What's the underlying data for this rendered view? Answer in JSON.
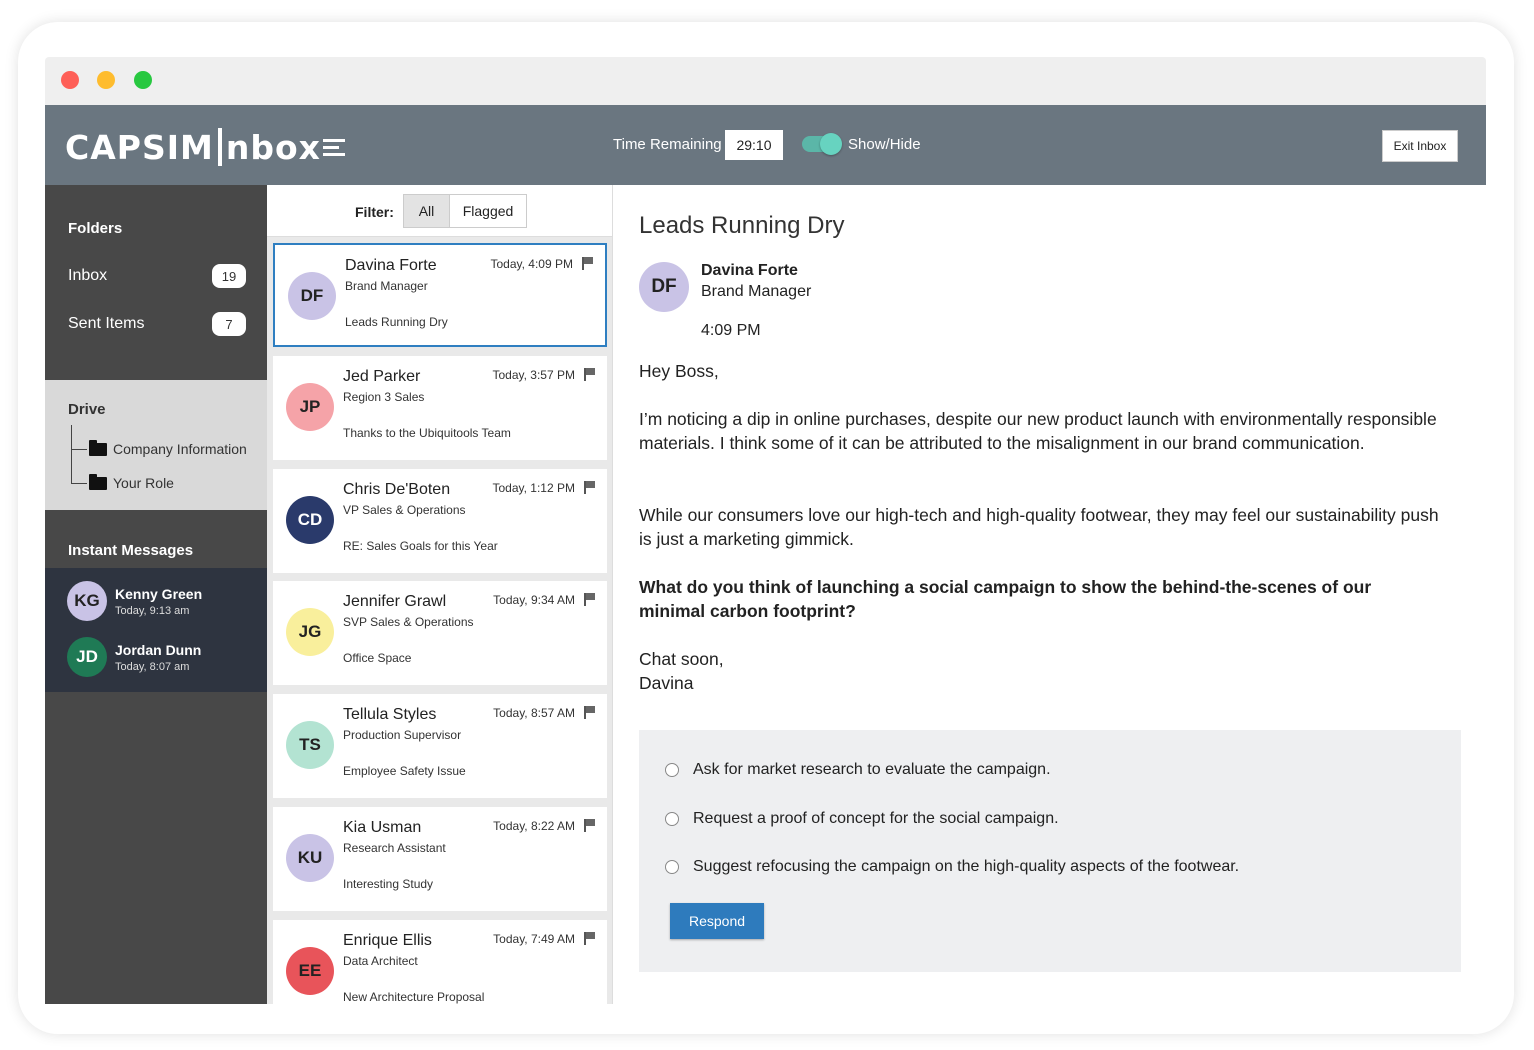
{
  "header": {
    "logo_left": "CAPSIM",
    "logo_right": "nbox",
    "timer_label": "Time Remaining",
    "timer_value": "29:10",
    "toggle_label": "Show/Hide",
    "toggle_on": true,
    "exit_label": "Exit Inbox"
  },
  "sidebar": {
    "folders_heading": "Folders",
    "folders": [
      {
        "label": "Inbox",
        "count": "19"
      },
      {
        "label": "Sent Items",
        "count": "7"
      }
    ],
    "drive_heading": "Drive",
    "drive_items": [
      {
        "label": "Company Information",
        "icon": "folder-icon"
      },
      {
        "label": "Your Role",
        "icon": "folder-icon"
      }
    ],
    "im_heading": "Instant Messages",
    "messages": [
      {
        "initials": "KG",
        "name": "Kenny Green",
        "time": "Today, 9:13 am",
        "color": "#c9c3e6",
        "text_color": "#222222"
      },
      {
        "initials": "JD",
        "name": "Jordan Dunn",
        "time": "Today, 8:07 am",
        "color": "#1f7a55",
        "text_color": "#ffffff"
      }
    ]
  },
  "mail_list": {
    "filter_label": "Filter:",
    "filter_all": "All",
    "filter_flagged": "Flagged",
    "items": [
      {
        "initials": "DF",
        "name": "Davina Forte",
        "role": "Brand Manager",
        "subject": "Leads Running Dry",
        "time": "Today, 4:09 PM",
        "color": "#c9c3e6",
        "selected": true
      },
      {
        "initials": "JP",
        "name": "Jed Parker",
        "role": "Region 3 Sales",
        "subject": "Thanks to the Ubiquitools Team",
        "time": "Today, 3:57 PM",
        "color": "#f5a3a8",
        "selected": false
      },
      {
        "initials": "CD",
        "name": "Chris De'Boten",
        "role": "VP Sales & Operations",
        "subject": "RE: Sales Goals for this Year",
        "time": "Today, 1:12 PM",
        "color": "#2a3a6b",
        "selected": false
      },
      {
        "initials": "JG",
        "name": "Jennifer Grawl",
        "role": "SVP Sales & Operations",
        "subject": "Office Space",
        "time": "Today, 9:34 AM",
        "color": "#f9ef9c",
        "selected": false
      },
      {
        "initials": "TS",
        "name": "Tellula Styles",
        "role": "Production Supervisor",
        "subject": "Employee Safety Issue",
        "time": "Today, 8:57 AM",
        "color": "#b3e3d2",
        "selected": false
      },
      {
        "initials": "KU",
        "name": "Kia Usman",
        "role": "Research Assistant",
        "subject": "Interesting Study",
        "time": "Today, 8:22 AM",
        "color": "#c9c3e6",
        "selected": false
      },
      {
        "initials": "EE",
        "name": "Enrique Ellis",
        "role": "Data Architect",
        "subject": "New Architecture Proposal",
        "time": "Today, 7:49 AM",
        "color": "#e8545a",
        "selected": false
      }
    ]
  },
  "reader": {
    "subject": "Leads Running Dry",
    "sender_initials": "DF",
    "sender_name": "Davina Forte",
    "sender_role": "Brand Manager",
    "sent_time": "4:09 PM",
    "greeting": "Hey Boss,",
    "para1": "I’m noticing a dip in online purchases, despite our new product launch with environmentally responsible materials. I think some of it can be attributed to the misalignment in our brand communication.",
    "para2": "While our consumers love our high-tech and high-quality footwear, they may feel our sustainability push is just a marketing gimmick.",
    "question": "What do you think of launching a social campaign to show the behind-the-scenes of our minimal carbon footprint?",
    "signoff1": "Chat soon,",
    "signoff2": "Davina",
    "options": [
      "Ask for market research to evaluate the campaign.",
      "Request a proof of concept for the social campaign.",
      "Suggest refocusing the campaign on the high-quality aspects of the footwear."
    ],
    "respond_label": "Respond"
  }
}
